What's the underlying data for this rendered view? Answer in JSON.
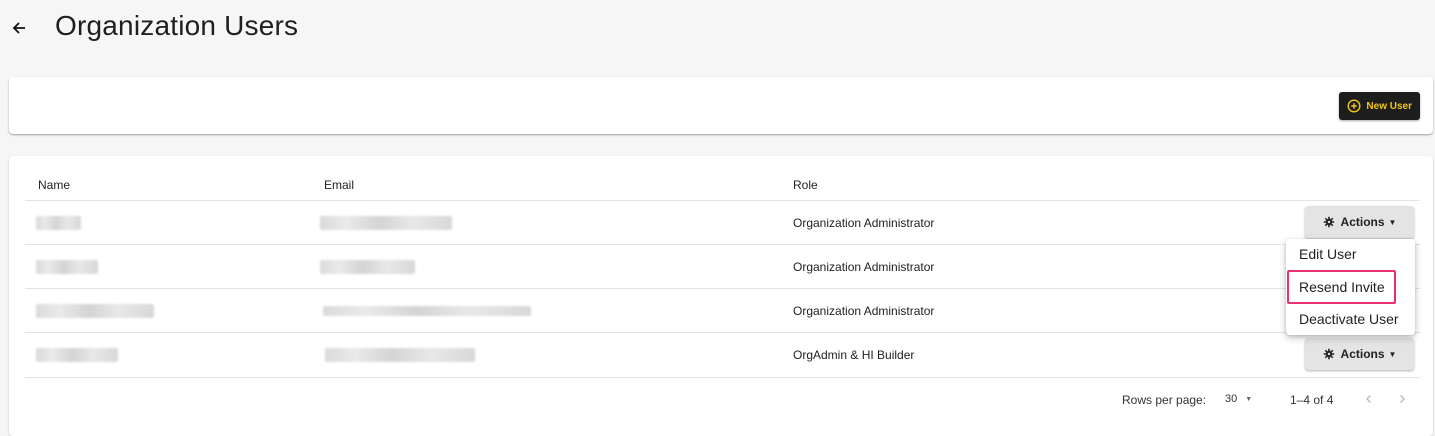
{
  "header": {
    "title": "Organization Users",
    "back_icon": "arrow-left-icon"
  },
  "toolbar": {
    "new_user_label": "New User",
    "new_user_icon": "plus-circle-icon",
    "accent": "#f3c614"
  },
  "table": {
    "columns": [
      "Name",
      "Email",
      "Role"
    ],
    "rows": [
      {
        "role": "Organization Administrator",
        "actions_label": "Actions"
      },
      {
        "role": "Organization Administrator"
      },
      {
        "role": "Organization Administrator"
      },
      {
        "role": "OrgAdmin & HI Builder",
        "actions_label": "Actions"
      }
    ]
  },
  "actions_menu": {
    "items": [
      "Edit User",
      "Resend Invite",
      "Deactivate User"
    ],
    "highlighted": "Resend Invite",
    "highlight_color": "#e8306b"
  },
  "pagination": {
    "rows_per_page_label": "Rows per page:",
    "rows_per_page_value": "30",
    "range_text": "1–4 of 4"
  }
}
